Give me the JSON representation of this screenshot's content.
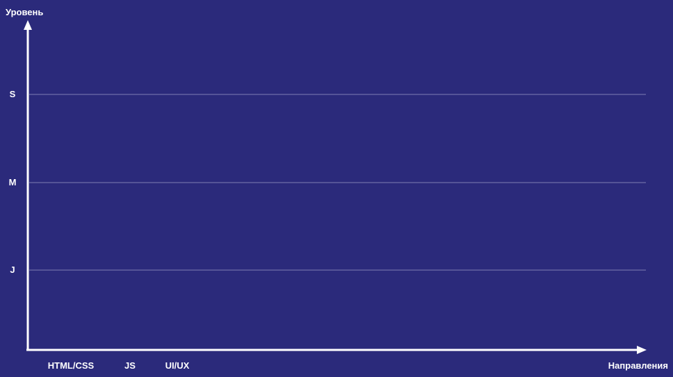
{
  "chart_data": {
    "type": "scatter",
    "xlabel": "Направления",
    "ylabel": "Уровень",
    "categories": [
      "HTML/CSS",
      "JS",
      "UI/UX"
    ],
    "y_levels": [
      "J",
      "M",
      "S"
    ],
    "grid": true,
    "series": []
  },
  "colors": {
    "background": "#2B2A7B",
    "axis": "#FFFFFF",
    "grid": "#7F7EB3",
    "text": "#FFFFFF"
  }
}
